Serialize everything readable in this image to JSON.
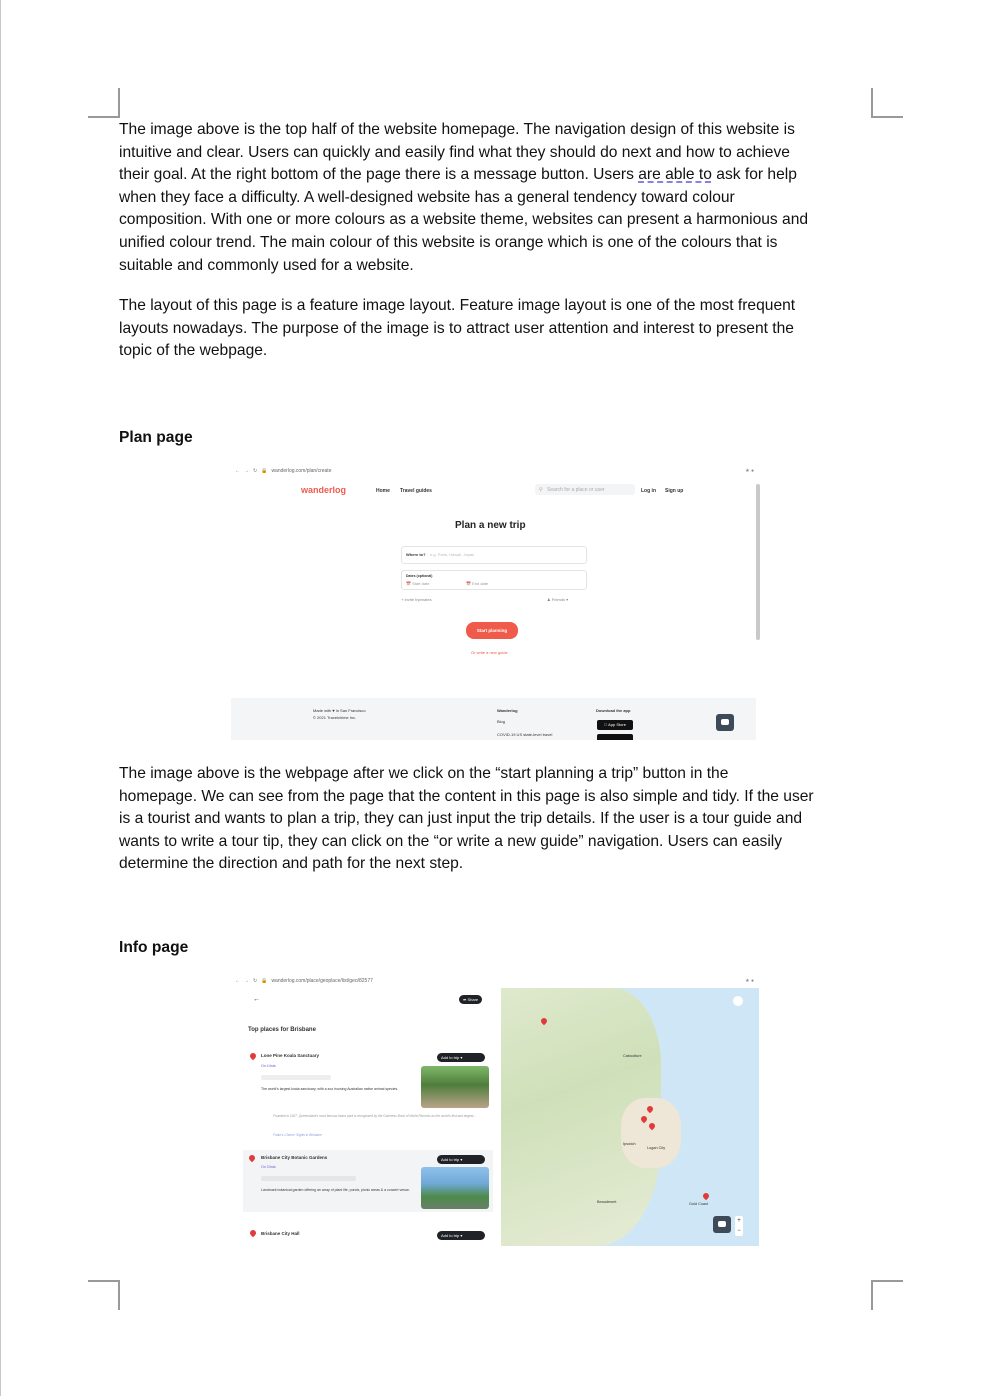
{
  "paragraph1": {
    "l1": "The image above is the top half of the website homepage. The navigation design of this website is",
    "l2": "intuitive and clear. Users can quickly and easily find what they should do next and how to achieve",
    "l3a": "their goal. At the right bottom of the page there is a message button. Users ",
    "l3u": "are able to",
    "l3b": " ask for help",
    "l4": "when they face a difficulty. A well-designed website has a general tendency toward colour",
    "l5": "composition. With one or more colours as a website theme, websites can present a harmonious and",
    "l6": "unified colour trend. The main colour of this website is orange which is one of the colours that is",
    "l7": "suitable and commonly used for a website."
  },
  "paragraph2": {
    "l1": "The layout of this page is a feature image layout. Feature image layout is one of the most frequent",
    "l2": "layouts nowadays. The purpose of the image is to attract user attention and interest to present the",
    "l3": "topic of the webpage."
  },
  "heading_plan": "Plan page",
  "plan_shot": {
    "url": "wanderlog.com/plan/create",
    "logo": "wanderlog",
    "nav_home": "Home",
    "nav_guides": "Travel guides",
    "search_placeholder": "Search for a place or user",
    "login": "Log in",
    "signup": "Sign up",
    "title": "Plan a new trip",
    "where_label": "Where to?",
    "where_placeholder": "e.g. Paris, Hawaii, Japan",
    "dates_label": "Dates (optional)",
    "start_date": "Start date",
    "end_date": "End date",
    "invite": "+ Invite tripmates",
    "friends": "Friends",
    "start_btn": "Start planning",
    "guide_link": "Or write a new guide",
    "footer_made": "Made with ♥ in San Francisco",
    "footer_copy": "© 2021 Travelchime Inc.",
    "footer_col1": "Wanderlog",
    "footer_blog": "Blog",
    "footer_covid": "COVID-19 US state-level travel",
    "footer_download": "Download the app",
    "app_store": "App Store"
  },
  "paragraph3": {
    "l1": "The image above is the webpage after we click on the “start planning a trip” button in the",
    "l2": "homepage. We can see from the page that the content in this page is also simple and tidy. If the user",
    "l3": "is a tourist and wants to plan a trip, they can just input the trip details. If the user is a tour guide and",
    "l4": "wants to write a tour tip, they can click on the “or write a new guide” navigation. Users can easily",
    "l5": "determine the direction and path for the next step."
  },
  "heading_info": "Info page",
  "info_shot": {
    "url": "wanderlog.com/place/geoplace/list/geo/82577",
    "share": "Share",
    "section_title": "Top places for Brisbane",
    "place1": "Lone Pine Koala Sanctuary",
    "place1_lists": "On 4 lists",
    "place1_desc": "The world's largest koala sanctuary, with a zoo housing Australian native animal species.",
    "place1_quote": "Founded in 1927, Queensland's most famous fauna park is recognized by the Guinness Book of World Records as the world's first and largest...",
    "place1_source": "Fodor's Choice: Sights in Brisbane",
    "place2": "Brisbane City Botanic Gardens",
    "place2_lists": "On 3 lists",
    "place2_desc": "Landmark botanical garden offering an array of plant life, ponds, picnic areas & a concert venue.",
    "place3": "Brisbane City Hall",
    "add_btn": "Add to trip",
    "map_labels": [
      "Caboolture",
      "Ipswich",
      "Logan City",
      "Gold Coast",
      "Beaudesert"
    ]
  },
  "colors": {
    "accent": "#f05a4a",
    "dark": "#1f2328",
    "map_water": "#cfe6f7",
    "map_land": "#e8efd8"
  }
}
